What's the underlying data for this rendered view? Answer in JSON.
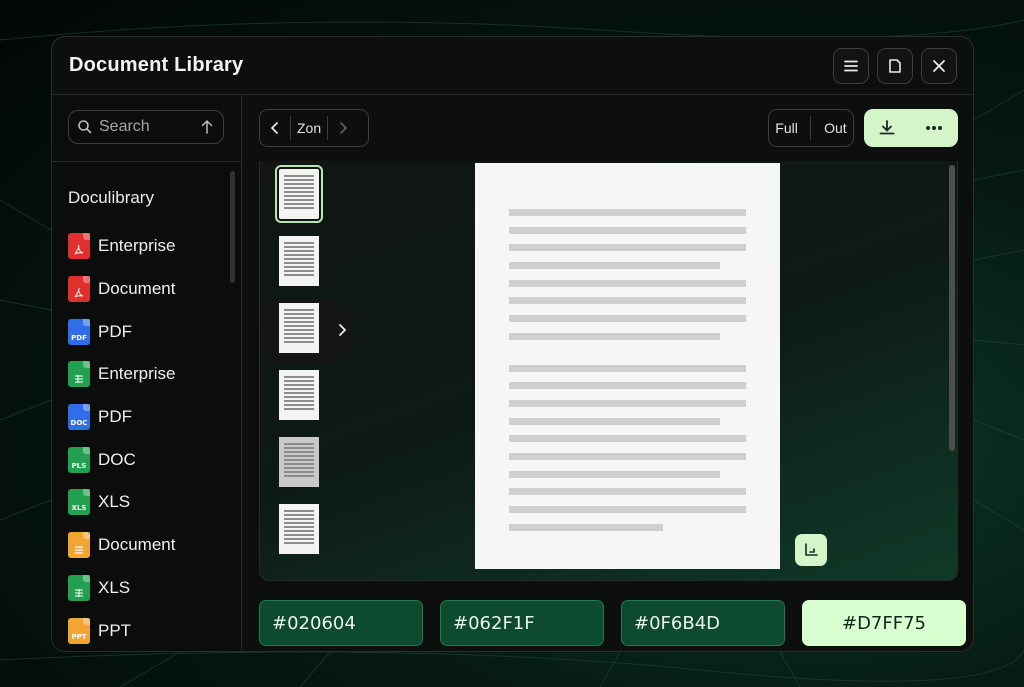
{
  "window": {
    "title": "Document Library"
  },
  "search": {
    "placeholder": "Search"
  },
  "sidebar": {
    "heading": "Doculibrary",
    "items": [
      {
        "label": "Enterprise",
        "icon": "pdf-icon",
        "color": "#e0302e",
        "badge": ""
      },
      {
        "label": "Document",
        "icon": "pdf-icon",
        "color": "#e0302e",
        "badge": ""
      },
      {
        "label": "PDF",
        "icon": "pdf-file-icon",
        "color": "#2f6ee8",
        "badge": "PDF"
      },
      {
        "label": "Enterprise",
        "icon": "sheet-icon",
        "color": "#22a04f",
        "badge": ""
      },
      {
        "label": "PDF",
        "icon": "doc-file-icon",
        "color": "#2f6ee8",
        "badge": "DOC"
      },
      {
        "label": "DOC",
        "icon": "xls-file-icon",
        "color": "#22a04f",
        "badge": "PLS"
      },
      {
        "label": "XLS",
        "icon": "xls-file-icon",
        "color": "#22a04f",
        "badge": "XLS"
      },
      {
        "label": "Document",
        "icon": "text-file-icon",
        "color": "#f2a531",
        "badge": ""
      },
      {
        "label": "XLS",
        "icon": "sheet-icon",
        "color": "#22a04f",
        "badge": ""
      },
      {
        "label": "PPT",
        "icon": "ppt-file-icon",
        "color": "#f2a531",
        "badge": "PPT"
      }
    ]
  },
  "toolbar": {
    "zoom_label": "Zon",
    "full_label": "Full",
    "out_label": "Out"
  },
  "swatches": [
    {
      "label": "#020604",
      "color": "#0e4a30"
    },
    {
      "label": "#062F1F",
      "color": "#0d4a30"
    },
    {
      "label": "#0F6B4D",
      "color": "#0d4a30"
    },
    {
      "label": "#D7FF75",
      "color": "#d7ffd0"
    }
  ]
}
